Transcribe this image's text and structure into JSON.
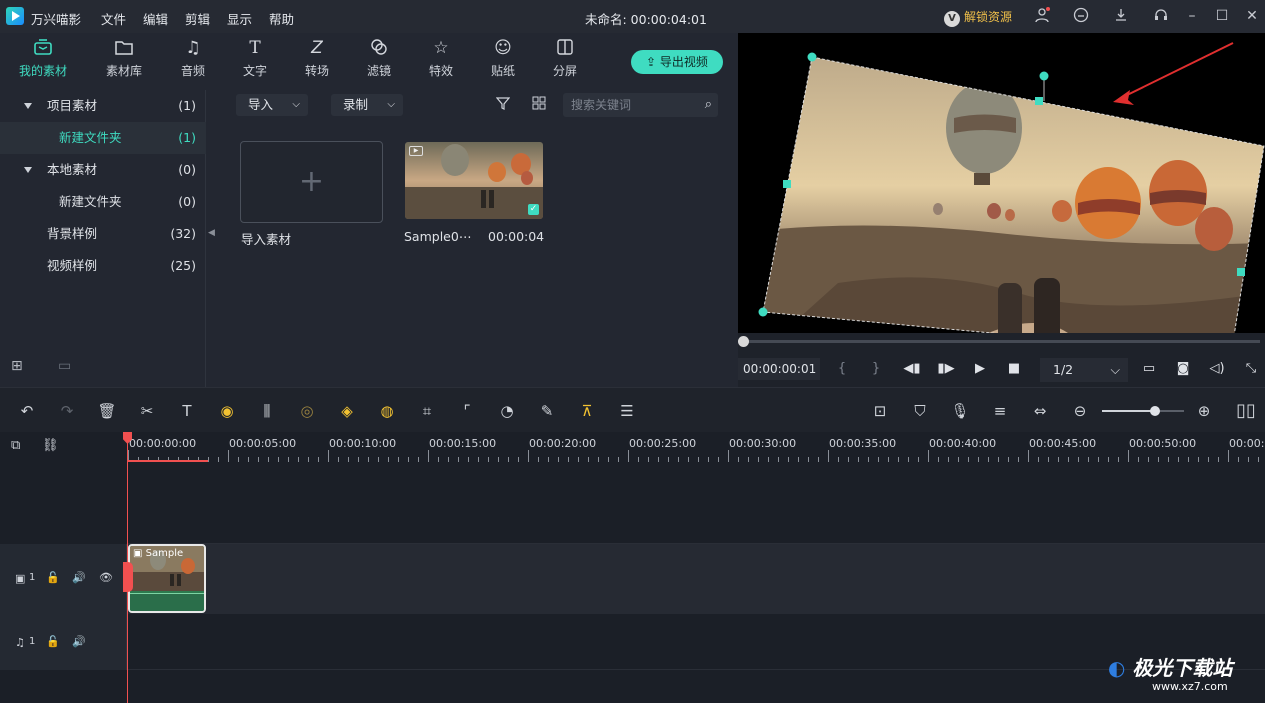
{
  "titlebar": {
    "app_name": "万兴喵影",
    "menus": [
      "文件",
      "编辑",
      "剪辑",
      "显示",
      "帮助"
    ],
    "project_title": "未命名: 00:00:04:01",
    "unlock_label": "解锁资源",
    "unlock_badge": "V"
  },
  "tabs": [
    {
      "label": "我的素材",
      "icon": "folder-media-icon",
      "active": true
    },
    {
      "label": "素材库",
      "icon": "folder-icon"
    },
    {
      "label": "音频",
      "icon": "music-note-icon"
    },
    {
      "label": "文字",
      "icon": "text-t-icon"
    },
    {
      "label": "转场",
      "icon": "transition-icon"
    },
    {
      "label": "滤镜",
      "icon": "filter-icon"
    },
    {
      "label": "特效",
      "icon": "sparkle-icon"
    },
    {
      "label": "贴纸",
      "icon": "sticker-icon"
    },
    {
      "label": "分屏",
      "icon": "split-screen-icon"
    }
  ],
  "export_label": "导出视频",
  "tree": [
    {
      "label": "项目素材",
      "count": "(1)",
      "expanded": true
    },
    {
      "label": "新建文件夹",
      "count": "(1)",
      "selected": true
    },
    {
      "label": "本地素材",
      "count": "(0)",
      "expanded": true
    },
    {
      "label": "新建文件夹",
      "count": "(0)"
    },
    {
      "label": "背景样例",
      "count": "(32)"
    },
    {
      "label": "视频样例",
      "count": "(25)"
    }
  ],
  "media_toolbar": {
    "import_label": "导入",
    "record_label": "录制",
    "search_placeholder": "搜索关键词"
  },
  "media_items": {
    "import_caption": "导入素材",
    "clip_name": "Sample0⋯",
    "clip_duration": "00:00:04"
  },
  "player": {
    "timecode": "00:00:00:01",
    "ratio": "1/2",
    "progress": 0.0
  },
  "ruler": {
    "ticks": [
      "00:00:00:00",
      "00:00:05:00",
      "00:00:10:00",
      "00:00:15:00",
      "00:00:20:00",
      "00:00:25:00",
      "00:00:30:00",
      "00:00:35:00",
      "00:00:40:00",
      "00:00:45:00",
      "00:00:50:00",
      "00:00:5"
    ]
  },
  "tracks": {
    "video_track_label": "1",
    "audio_track_label": "1",
    "clip_label": "Sample"
  },
  "zoom_level": 0.65,
  "watermark": {
    "brand": "极光下载站",
    "url": "www.xz7.com"
  },
  "colors": {
    "accent": "#3fdcc1",
    "playhead": "#f15050",
    "yellow_tools": "#f2c232"
  }
}
